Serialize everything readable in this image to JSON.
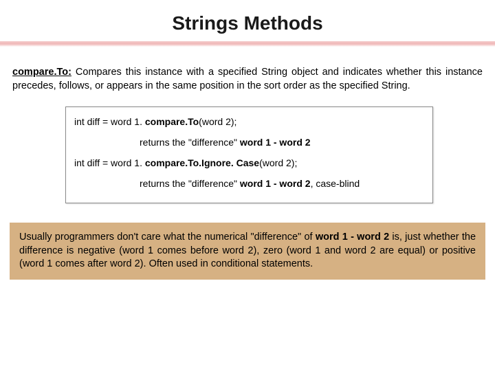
{
  "title": "Strings Methods",
  "desc": {
    "method": "compare.To:",
    "text": " Compares this instance with a specified String object and indicates whether this instance precedes, follows, or appears in the same position in the sort order as the specified String."
  },
  "code": {
    "line1_pre": "int diff = word 1. ",
    "line1_bold": "compare.To",
    "line1_post": "(word 2);",
    "ret1_pre": "returns the \"difference\" ",
    "ret1_bold": "word 1 - word 2",
    "line2_pre": "int diff = word 1. ",
    "line2_bold": "compare.To.Ignore. Case",
    "line2_post": "(word 2);",
    "ret2_pre": "returns the \"difference\" ",
    "ret2_bold": "word 1 - word 2",
    "ret2_post": ", case-blind"
  },
  "bottom": {
    "p1": "Usually programmers don't care what the numerical \"difference\" of ",
    "b1": "word 1 - word 2",
    "p2": " is, just whether the difference is negative (word 1 comes before word 2), zero (word 1 and word 2 are equal) or positive (word 1 comes after word 2).  Often used in conditional statements."
  }
}
